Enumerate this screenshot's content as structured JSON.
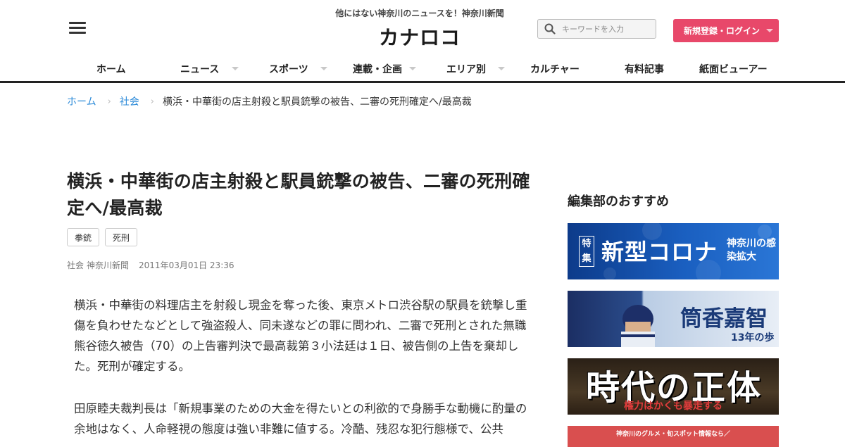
{
  "header": {
    "tagline": "他にはない神奈川のニュースを！神奈川新聞",
    "logo": "カナロコ",
    "search_placeholder": "キーワードを入力",
    "login_label": "新規登録・ログイン"
  },
  "nav": [
    {
      "label": "ホーム",
      "dropdown": false
    },
    {
      "label": "ニュース",
      "dropdown": true
    },
    {
      "label": "スポーツ",
      "dropdown": true
    },
    {
      "label": "連載・企画",
      "dropdown": true
    },
    {
      "label": "エリア別",
      "dropdown": true
    },
    {
      "label": "カルチャー",
      "dropdown": false
    },
    {
      "label": "有料記事",
      "dropdown": false
    },
    {
      "label": "紙面ビューアー",
      "dropdown": false
    }
  ],
  "breadcrumb": {
    "home": "ホーム",
    "category": "社会",
    "current": "横浜・中華街の店主射殺と駅員銃撃の被告、二審の死刑確定へ/最高裁"
  },
  "article": {
    "title": "横浜・中華街の店主射殺と駅員銃撃の被告、二審の死刑確定へ/最高裁",
    "tags": [
      "拳銃",
      "死刑"
    ],
    "category": "社会",
    "publisher": "神奈川新聞",
    "date": "2011年03月01日 23:36",
    "paragraphs": [
      "横浜・中華街の料理店主を射殺し現金を奪った後、東京メトロ渋谷駅の駅員を銃撃し重傷を負わせたなどとして強盗殺人、同未遂などの罪に問われ、二審で死刑とされた無職熊谷徳久被告（70）の上告審判決で最高裁第３小法廷は１日、被告側の上告を棄却した。死刑が確定する。",
      "田原睦夫裁判長は「新規事業のための大金を得たいとの利欲的で身勝手な動機に酌量の余地はなく、人命軽視の態度は強い非難に値する。冷酷、残忍な犯行態様で、公共"
    ]
  },
  "sidebar": {
    "heading": "編集部のおすすめ",
    "banners": [
      {
        "tag": "特集",
        "title": "新型コロナ",
        "subtitle": "神奈川の感染拡大"
      },
      {
        "title": "筒香嘉智",
        "subtitle": "13年の歩み"
      },
      {
        "title": "時代の正体",
        "subtitle": "権力はかくも暴走する"
      },
      {
        "subtitle": "神奈川のグルメ・旬スポット情報なら／"
      }
    ]
  },
  "colors": {
    "accent_pink": "#e8486a",
    "link_blue": "#2b8ad8"
  }
}
